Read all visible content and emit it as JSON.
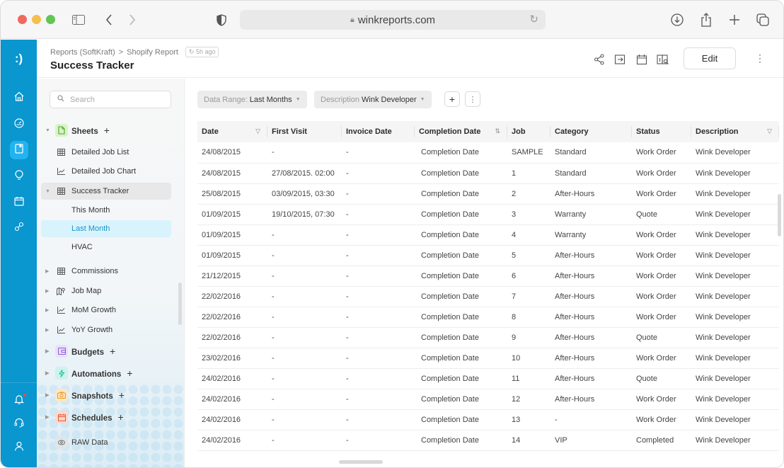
{
  "browser": {
    "url": "winkreports.com"
  },
  "app": {
    "logo": ":)"
  },
  "header": {
    "breadcrumb": [
      "Reports (SoftKraft)",
      "Shopify Report"
    ],
    "breadcrumb_separator": ">",
    "last_updated": "5h ago",
    "title": "Success Tracker",
    "edit_label": "Edit",
    "more_label": "⋮"
  },
  "sidebar": {
    "search_placeholder": "Search",
    "sheets": {
      "label": "Sheets",
      "plus": "+",
      "items": [
        {
          "label": "Detailed Job List",
          "icon": "table-icon"
        },
        {
          "label": "Detailed Job Chart",
          "icon": "line-chart-icon"
        },
        {
          "label": "Success Tracker",
          "icon": "table-icon",
          "expanded": true,
          "children": [
            "This Month",
            "Last Month",
            "HVAC"
          ],
          "active_child": "Last Month"
        },
        {
          "label": "Commissions",
          "icon": "table-icon"
        },
        {
          "label": "Job Map",
          "icon": "map-icon"
        },
        {
          "label": "MoM Growth",
          "icon": "line-chart-icon"
        },
        {
          "label": "YoY Growth",
          "icon": "line-chart-icon"
        }
      ]
    },
    "sections": [
      {
        "label": "Budgets",
        "plus": "+",
        "color": "#8b5cd6",
        "bg": "#ece1fb"
      },
      {
        "label": "Automations",
        "plus": "+",
        "color": "#1fb89b",
        "bg": "#cdf3ea"
      },
      {
        "label": "Snapshots",
        "plus": "+",
        "color": "#e89a2c",
        "bg": "#fde6c4"
      },
      {
        "label": "Schedules",
        "plus": "+",
        "color": "#e5573c",
        "bg": "#fcd8cd"
      }
    ],
    "raw_data_label": "RAW Data"
  },
  "filters": [
    {
      "key": "Data Range:",
      "value": "Last Months"
    },
    {
      "key": "Description",
      "value": "Wink Developer"
    }
  ],
  "filter_actions": {
    "add": "+",
    "more": "⋮"
  },
  "table": {
    "columns": [
      "Date",
      "First Visit",
      "Invoice Date",
      "Completion Date",
      "Job",
      "Category",
      "Status",
      "Description"
    ],
    "rows": [
      [
        "24/08/2015",
        "-",
        "-",
        "Completion Date",
        "SAMPLE",
        "Standard",
        "Work Order",
        "Wink Developer"
      ],
      [
        "24/08/2015",
        "27/08/2015. 02:00",
        "-",
        "Completion Date",
        "1",
        "Standard",
        "Work Order",
        "Wink Developer"
      ],
      [
        "25/08/2015",
        "03/09/2015, 03:30",
        "-",
        "Completion Date",
        "2",
        "After-Hours",
        "Work Order",
        "Wink Developer"
      ],
      [
        "01/09/2015",
        "19/10/2015, 07:30",
        "-",
        "Completion Date",
        "3",
        "Warranty",
        "Quote",
        "Wink Developer"
      ],
      [
        "01/09/2015",
        "-",
        "-",
        "Completion Date",
        "4",
        "Warranty",
        "Work Order",
        "Wink Developer"
      ],
      [
        "01/09/2015",
        "-",
        "-",
        "Completion Date",
        "5",
        "After-Hours",
        "Work Order",
        "Wink Developer"
      ],
      [
        "21/12/2015",
        "-",
        "-",
        "Completion Date",
        "6",
        "After-Hours",
        "Work Order",
        "Wink Developer"
      ],
      [
        "22/02/2016",
        "-",
        "-",
        "Completion Date",
        "7",
        "After-Hours",
        "Work Order",
        "Wink Developer"
      ],
      [
        "22/02/2016",
        "-",
        "-",
        "Completion Date",
        "8",
        "After-Hours",
        "Work Order",
        "Wink Developer"
      ],
      [
        "22/02/2016",
        "-",
        "-",
        "Completion Date",
        "9",
        "After-Hours",
        "Quote",
        "Wink Developer"
      ],
      [
        "23/02/2016",
        "-",
        "-",
        "Completion Date",
        "10",
        "After-Hours",
        "Work Order",
        "Wink Developer"
      ],
      [
        "24/02/2016",
        "-",
        "-",
        "Completion Date",
        "11",
        "After-Hours",
        "Quote",
        "Wink Developer"
      ],
      [
        "24/02/2016",
        "-",
        "-",
        "Completion Date",
        "12",
        "After-Hours",
        "Work Order",
        "Wink Developer"
      ],
      [
        "24/02/2016",
        "-",
        "-",
        "Completion Date",
        "13",
        "-",
        "Work Order",
        "Wink Developer"
      ],
      [
        "24/02/2016",
        "-",
        "-",
        "Completion Date",
        "14",
        "VIP",
        "Completed",
        "Wink Developer"
      ]
    ]
  },
  "colors": {
    "brand": "#0a96cf",
    "rail_active": "#23b3ee",
    "active_item_bg": "#d9f3fd",
    "active_item_text": "#1a95c9"
  }
}
